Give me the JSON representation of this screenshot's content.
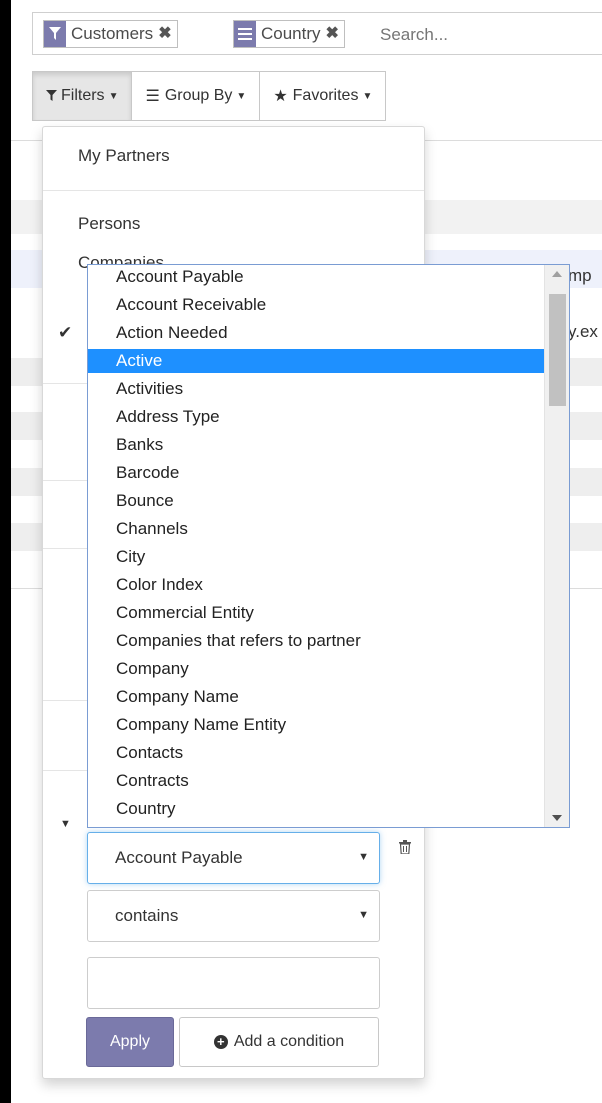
{
  "search": {
    "facets": [
      {
        "label": "Customers",
        "icon": "filter-icon"
      },
      {
        "label": "Country",
        "icon": "groupby-icon"
      }
    ],
    "placeholder": "Search..."
  },
  "toolbar": {
    "filters_label": "Filters",
    "groupby_label": "Group By",
    "favorites_label": "Favorites"
  },
  "filters_menu": {
    "items_visible": [
      "My Partners",
      "Persons",
      "Companies"
    ],
    "custom_field_value": "Account Payable",
    "custom_operator_value": "contains",
    "custom_value": "",
    "apply_label": "Apply",
    "add_condition_label": "Add a condition"
  },
  "field_list": {
    "selected": "Active",
    "options": [
      "Account Payable",
      "Account Receivable",
      "Action Needed",
      "Active",
      "Activities",
      "Address Type",
      "Banks",
      "Barcode",
      "Bounce",
      "Channels",
      "City",
      "Color Index",
      "Commercial Entity",
      "Companies that refers to partner",
      "Company",
      "Company Name",
      "Company Name Entity",
      "Contacts",
      "Contracts",
      "Country"
    ]
  },
  "background_text": {
    "row1_tail": "mp",
    "row2_tail": "y.ex"
  },
  "colors": {
    "accent": "#7c7bad",
    "selection": "#1e90ff"
  }
}
